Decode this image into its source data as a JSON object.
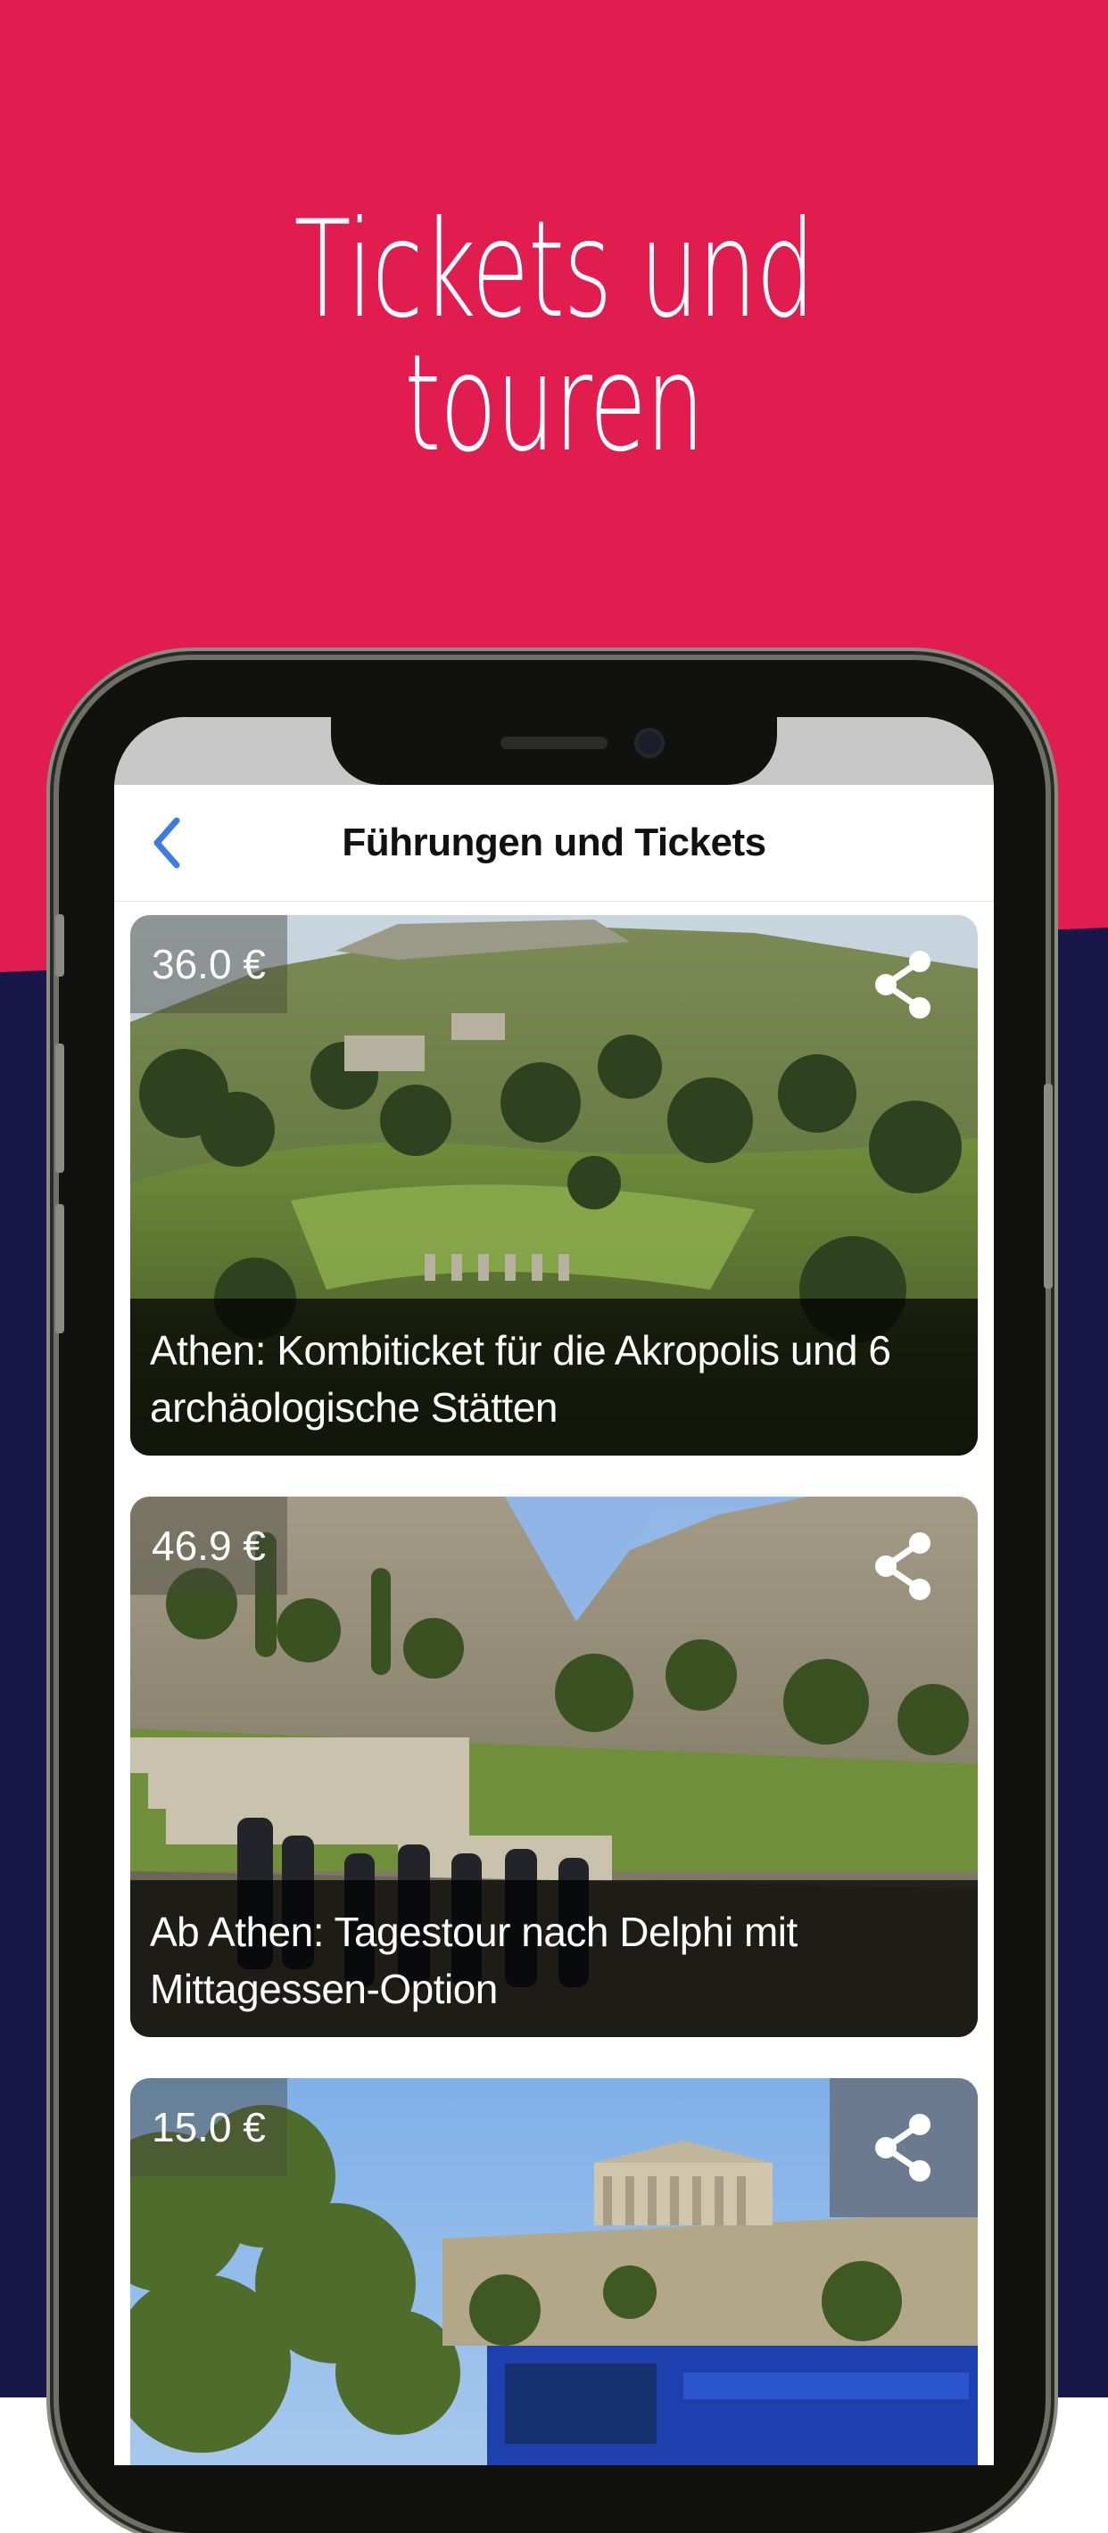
{
  "promo": {
    "headline_line1": "Tickets und",
    "headline_line2": "touren"
  },
  "colors": {
    "brand_red": "#e11c4e",
    "brand_navy": "#17174a",
    "accent_blue": "#3b7be8"
  },
  "navbar": {
    "back_icon": "chevron-left-icon",
    "title": "Führungen und Tickets"
  },
  "tours": [
    {
      "price": "36.0 €",
      "title": "Athen: Kombiticket für die Akropolis und 6 archäologische Stätten",
      "share_icon": "share-icon"
    },
    {
      "price": "46.9 €",
      "title": "Ab Athen: Tagestour nach Delphi mit Mittagessen-Option",
      "share_icon": "share-icon"
    },
    {
      "price": "15.0 €",
      "title": "",
      "share_icon": "share-icon"
    }
  ]
}
